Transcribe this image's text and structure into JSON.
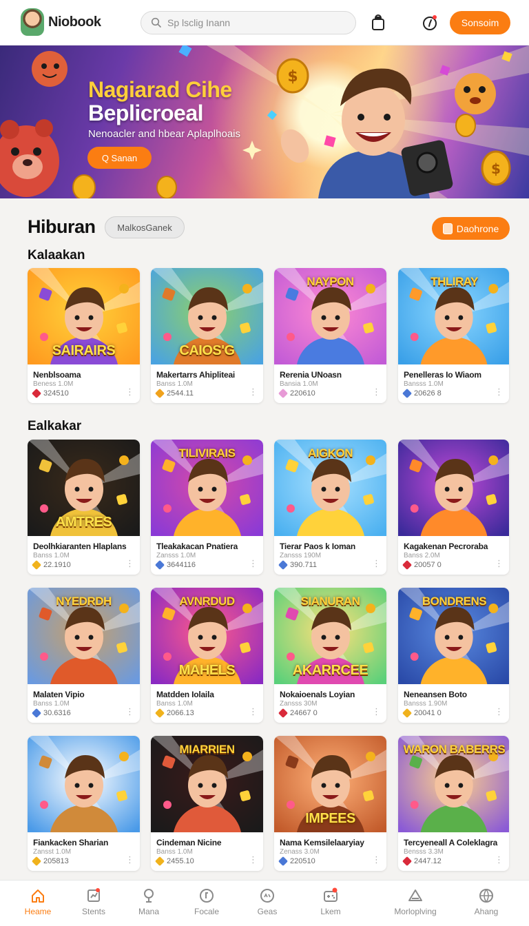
{
  "header": {
    "logo_text": "Niobook",
    "search_placeholder": "Sp lsclig Inann",
    "signin_label": "Sonsoim"
  },
  "hero": {
    "title_line1": "Nagiarad Cihe",
    "title_line2": "Beplicroeal",
    "subtitle": "Nenoacler and hbear Aplaplhoais",
    "button_label": "Q Sanan"
  },
  "section": {
    "title": "Hiburan",
    "pill_label": "MalkosGanek",
    "action_label": "Daohrone"
  },
  "groups": [
    {
      "title": "Kalaakan",
      "items": [
        {
          "name": "Nenblsoama",
          "sub": "Beness 1.0M",
          "stat": "324510",
          "gem": "#d92a3a",
          "thumb_top": "",
          "thumb_bottom": "SAIRAIRS",
          "colors": [
            "#ff9a1f",
            "#ffd23a",
            "#8a4bd6"
          ]
        },
        {
          "name": "Makertarrs Ahipliteai",
          "sub": "Banss 1.0M",
          "stat": "2544.11",
          "gem": "#f0a21c",
          "thumb_top": "",
          "thumb_bottom": "CAIOS'G",
          "colors": [
            "#4aa3e0",
            "#8ed06a",
            "#e07a2a"
          ]
        },
        {
          "name": "Rerenia UNoasn",
          "sub": "Bansia 1.0M",
          "stat": "220610",
          "gem": "#e79ad6",
          "thumb_top": "NAYPON",
          "thumb_bottom": "",
          "colors": [
            "#c25bd6",
            "#ff8ad2",
            "#4a7be0"
          ]
        },
        {
          "name": "Penelleras Io Wiaom",
          "sub": "Bansss 1.0M",
          "stat": "20626 8",
          "gem": "#4a78d6",
          "thumb_top": "THLIRAY",
          "thumb_bottom": "",
          "colors": [
            "#3aa0e8",
            "#8ad6ff",
            "#ff9a2a"
          ]
        }
      ]
    },
    {
      "title": "Ealkakar",
      "items": [
        {
          "name": "Deolhkiaranten Hlaplans",
          "sub": "Banss 1.0M",
          "stat": "22.1910",
          "gem": "#f0b21c",
          "thumb_top": "",
          "thumb_bottom": "AMTRES",
          "colors": [
            "#1a1a1a",
            "#3a2a1a",
            "#f0c23a"
          ]
        },
        {
          "name": "Tleakakacan Pnatiera",
          "sub": "Zansss 1.0M",
          "stat": "3644116",
          "gem": "#4a78d6",
          "thumb_top": "TILIVIRAIS",
          "thumb_bottom": "",
          "colors": [
            "#8a3ad6",
            "#d64aa8",
            "#ffb22a"
          ]
        },
        {
          "name": "Tierar Paos k Ioman",
          "sub": "Zansss 190M",
          "stat": "390.711",
          "gem": "#4a78d6",
          "thumb_top": "AIGKON",
          "thumb_bottom": "",
          "colors": [
            "#4ab0f0",
            "#a8e0ff",
            "#ffd23a"
          ]
        },
        {
          "name": "Kagakenan Pecroraba",
          "sub": "Banss 2.0M",
          "stat": "20057 0",
          "gem": "#d92a3a",
          "thumb_top": "",
          "thumb_bottom": "",
          "colors": [
            "#3a2a9a",
            "#c24ad6",
            "#ff8a2a"
          ]
        }
      ]
    },
    {
      "title": "",
      "items": [
        {
          "name": "Malaten Vipio",
          "sub": "Banss 1.0M",
          "stat": "30.6316",
          "gem": "#4a78d6",
          "thumb_top": "NYEDRDH",
          "thumb_bottom": "",
          "colors": [
            "#6a9ae0",
            "#c8a06a",
            "#e05a2a"
          ]
        },
        {
          "name": "Matdden Iolaila",
          "sub": "Banss 1.0M",
          "stat": "2066.13",
          "gem": "#f0b21c",
          "thumb_top": "AVNRDUD",
          "thumb_bottom": "MAHELS",
          "colors": [
            "#8a2ac2",
            "#ff5a8a",
            "#ffb22a"
          ]
        },
        {
          "name": "Nokaioenals Loyian",
          "sub": "Zansss 30M",
          "stat": "24667 0",
          "gem": "#d92a3a",
          "thumb_top": "SIANURAN",
          "thumb_bottom": "AKARRCEE",
          "colors": [
            "#5ad07a",
            "#ffe07a",
            "#e04ab0"
          ]
        },
        {
          "name": "Neneansen Boto",
          "sub": "Bansss 1.90M",
          "stat": "20041 0",
          "gem": "#f0b21c",
          "thumb_top": "BONDRENS",
          "thumb_bottom": "",
          "colors": [
            "#2a4aa8",
            "#5a8ae0",
            "#ffb22a"
          ]
        }
      ]
    },
    {
      "title": "",
      "items": [
        {
          "name": "Fiankacken Sharian",
          "sub": "Zansst 1.0M",
          "stat": "205813",
          "gem": "#f0b21c",
          "thumb_top": "",
          "thumb_bottom": "",
          "colors": [
            "#4a9ae8",
            "#ffffff",
            "#d08a3a"
          ]
        },
        {
          "name": "Cindeman Nicine",
          "sub": "Banss 1.0M",
          "stat": "2455.10",
          "gem": "#f0b21c",
          "thumb_top": "MIARRIEN",
          "thumb_bottom": "",
          "colors": [
            "#1a1a1a",
            "#3a1a1a",
            "#e05a3a"
          ]
        },
        {
          "name": "Nama Kemsilelaaryiay",
          "sub": "Zenass 3.0M",
          "stat": "220510",
          "gem": "#4a78d6",
          "thumb_top": "",
          "thumb_bottom": "IMPEES",
          "colors": [
            "#c25a2a",
            "#ffb27a",
            "#8a3a1a"
          ]
        },
        {
          "name": "Tercyeneall A Coleklagra",
          "sub": "Bensss 3.3M",
          "stat": "2447.12",
          "gem": "#d92a3a",
          "thumb_top": "WARON BABERRS",
          "thumb_bottom": "",
          "colors": [
            "#8a5ad6",
            "#ffd28a",
            "#5ab04a"
          ]
        }
      ]
    }
  ],
  "nav": [
    {
      "label": "Heame",
      "icon": "home-icon",
      "active": true
    },
    {
      "label": "Stents",
      "icon": "stats-icon",
      "active": false
    },
    {
      "label": "Mana",
      "icon": "pin-icon",
      "active": false
    },
    {
      "label": "Focale",
      "icon": "focal-icon",
      "active": false
    },
    {
      "label": "Geas",
      "icon": "gear-icon",
      "active": false
    },
    {
      "label": "Lkem",
      "icon": "gamepad-icon",
      "active": false
    },
    {
      "label": "Morloplving",
      "icon": "warning-icon",
      "active": false
    },
    {
      "label": "Ahang",
      "icon": "ball-icon",
      "active": false
    }
  ],
  "colors": {
    "accent": "#fb7d12",
    "background": "#f4f3f1"
  }
}
